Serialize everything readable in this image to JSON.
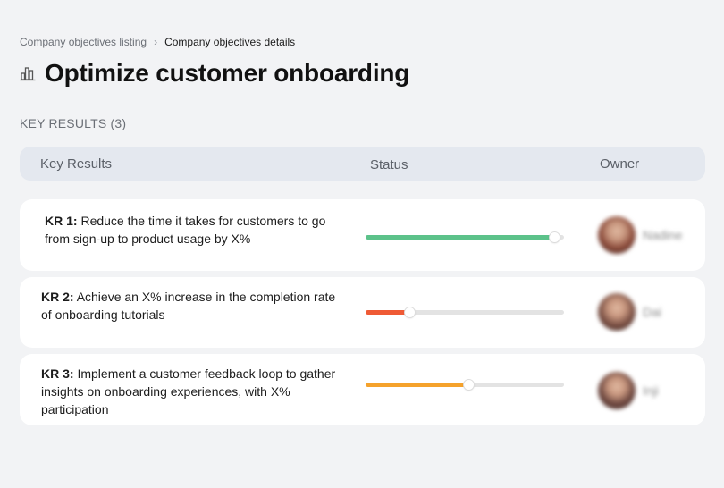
{
  "breadcrumb": {
    "parent": "Company objectives listing",
    "separator": "›",
    "current": "Company objectives details"
  },
  "page": {
    "title": "Optimize customer onboarding",
    "title_icon": "chart-building-icon"
  },
  "section": {
    "label": "KEY RESULTS (3)"
  },
  "table": {
    "headers": {
      "key_results": "Key Results",
      "status": "Status",
      "owner": "Owner"
    },
    "rows": [
      {
        "prefix": "KR 1:",
        "text": "Reduce the time it takes for customers to go from sign-up to product usage by X%",
        "progress": 0.95,
        "bar_color": "#5cc28a",
        "owner_name": "Nadine",
        "avatar_color": "#8a4a3a"
      },
      {
        "prefix": "KR 2:",
        "text": "Achieve an X% increase in the completion rate of onboarding tutorials",
        "progress": 0.22,
        "bar_color": "#ef5a35",
        "owner_name": "Dai",
        "avatar_color": "#7a5044"
      },
      {
        "prefix": "KR 3:",
        "text": "Implement a customer feedback loop to gather insights on onboarding experiences, with X% participation",
        "progress": 0.52,
        "bar_color": "#f5a22c",
        "owner_name": "Inji",
        "avatar_color": "#6e4840"
      }
    ]
  }
}
